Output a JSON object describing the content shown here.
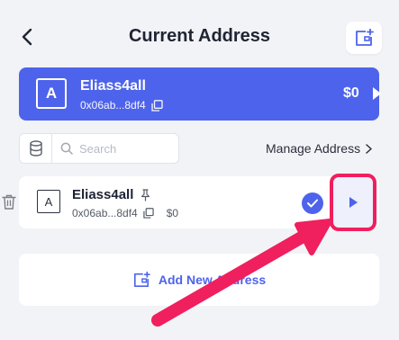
{
  "header": {
    "title": "Current Address"
  },
  "current": {
    "avatar_letter": "A",
    "name": "Eliass4all",
    "address": "0x06ab...8df4",
    "balance": "$0"
  },
  "search": {
    "placeholder": "Search"
  },
  "manage": {
    "label": "Manage Address"
  },
  "address_list": [
    {
      "avatar_letter": "A",
      "name": "Eliass4all",
      "address": "0x06ab...8df4",
      "balance": "$0",
      "selected": true
    }
  ],
  "add_new": {
    "label": "Add New Address"
  },
  "colors": {
    "accent": "#4e63eb",
    "highlight": "#f01f5e",
    "background": "#f2f3f6"
  }
}
